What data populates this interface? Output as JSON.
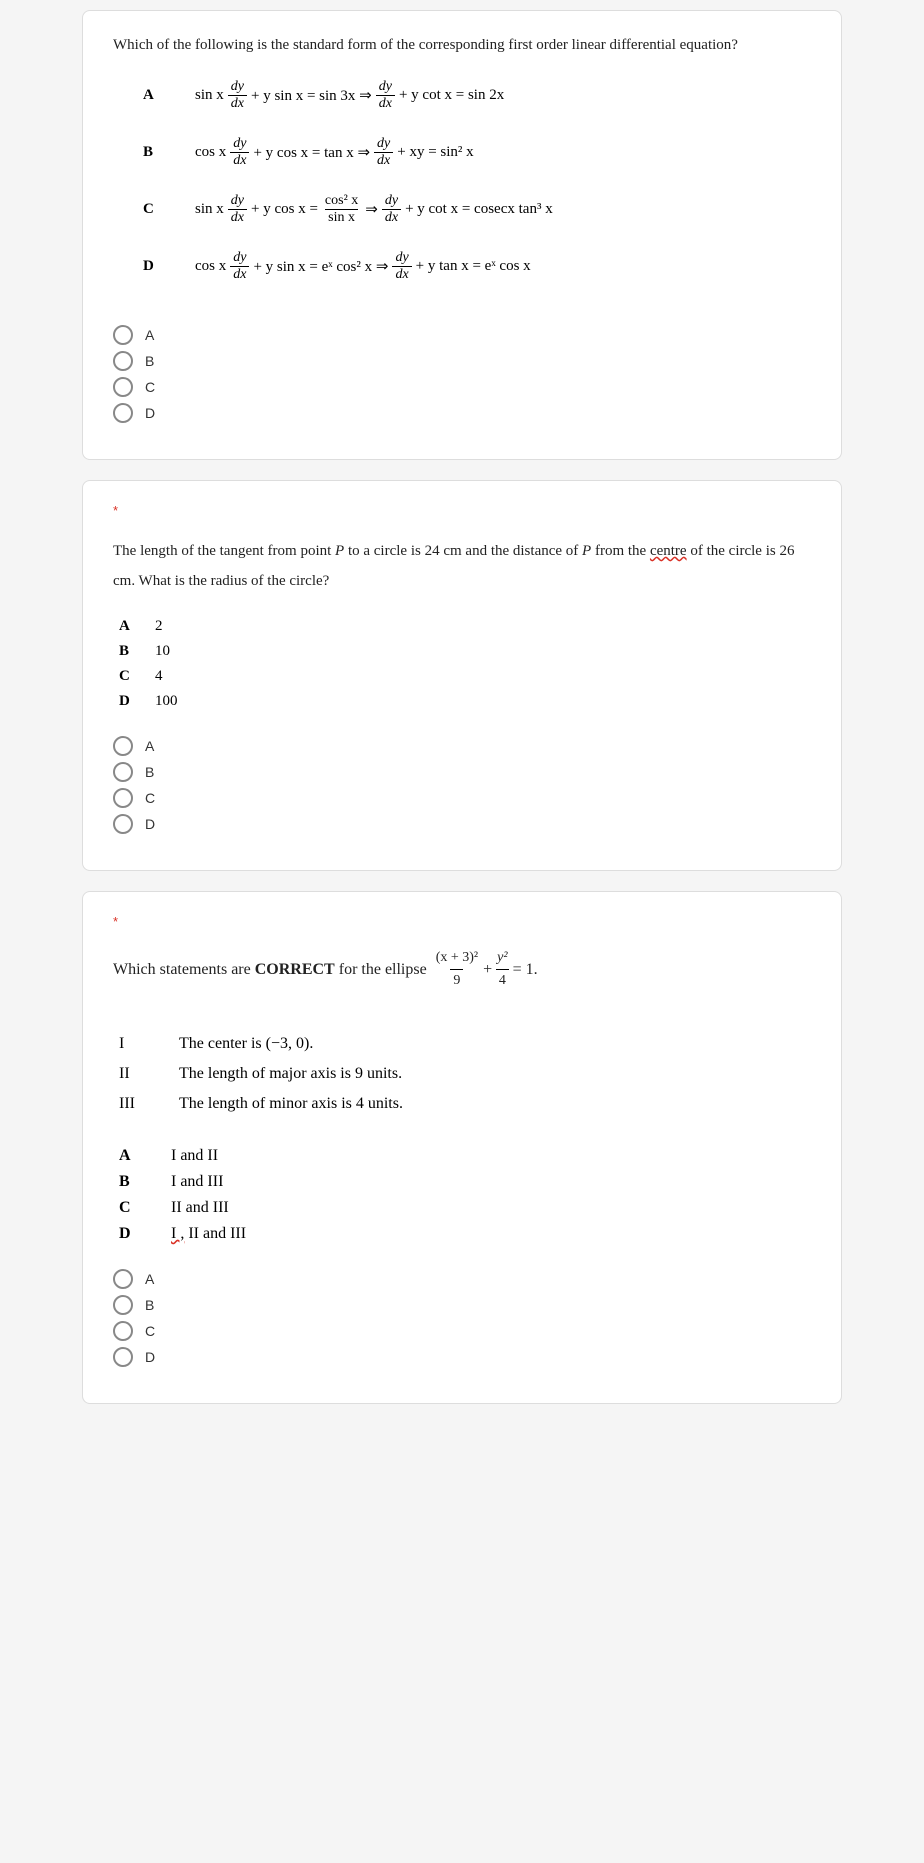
{
  "q1": {
    "prompt": "Which of the following is the standard form of the corresponding first order linear differential equation?",
    "options": {
      "A": {
        "label": "A",
        "eq_pre1": "sin x",
        "eq_mid1": "+ y sin x = sin 3x ⇒",
        "eq_post1": "+ y cot x = sin 2x"
      },
      "B": {
        "label": "B",
        "eq_pre1": "cos x",
        "eq_mid1": "+ y cos x = tan x ⇒",
        "eq_post1": "+ xy = sin² x"
      },
      "C": {
        "label": "C",
        "eq_pre1": "sin x",
        "eq_mid1": "+ y cos x =",
        "eq_mid2": "⇒",
        "eq_post1": "+ y cot x = cosecx tan³ x"
      },
      "D": {
        "label": "D",
        "eq_pre1": "cos x",
        "eq_mid1": "+ y sin x = eˣ cos² x ⇒",
        "eq_post1": "+ y tan x = eˣ cos x"
      }
    },
    "frac_dy": {
      "num": "dy",
      "den": "dx"
    },
    "frac_cos2_sin": {
      "num": "cos² x",
      "den": "sin x"
    },
    "radios": {
      "A": "A",
      "B": "B",
      "C": "C",
      "D": "D"
    }
  },
  "q2": {
    "prompt_part1": "The length of the tangent from point ",
    "prompt_P": "P",
    "prompt_part2": " to a circle is 24 cm and the distance of ",
    "prompt_part3": " from the ",
    "prompt_centre": "centre",
    "prompt_part4": " of the circle is 26 cm. What is the radius of the circle?",
    "options": {
      "A": {
        "label": "A",
        "val": "2"
      },
      "B": {
        "label": "B",
        "val": "10"
      },
      "C": {
        "label": "C",
        "val": "4"
      },
      "D": {
        "label": "D",
        "val": "100"
      }
    },
    "radios": {
      "A": "A",
      "B": "B",
      "C": "C",
      "D": "D"
    }
  },
  "q3": {
    "prompt_pre": "Which statements are ",
    "prompt_bold": "CORRECT",
    "prompt_post": " for the ellipse ",
    "frac1": {
      "num": "(x + 3)²",
      "den": "9"
    },
    "plus": "+",
    "frac2": {
      "num": "y²",
      "den": "4"
    },
    "eq": " = 1.",
    "statements": {
      "I": {
        "label": "I",
        "text_pre": "The center is ",
        "text_math": "(−3, 0)",
        "text_post": "."
      },
      "II": {
        "label": "II",
        "text_pre": "The length of major axis is 9 units.",
        "text_math": "",
        "text_post": ""
      },
      "III": {
        "label": "III",
        "text_pre": "The length of minor axis is 4 units.",
        "text_math": "",
        "text_post": ""
      }
    },
    "options": {
      "A": {
        "label": "A",
        "val": "I and II"
      },
      "B": {
        "label": "B",
        "val": "I and III"
      },
      "C": {
        "label": "C",
        "val": "II and III"
      },
      "D": {
        "label": "D",
        "val_pre": "I ,",
        "val_post": " II and III"
      }
    },
    "radios": {
      "A": "A",
      "B": "B",
      "C": "C",
      "D": "D"
    }
  },
  "asterisk": "*"
}
